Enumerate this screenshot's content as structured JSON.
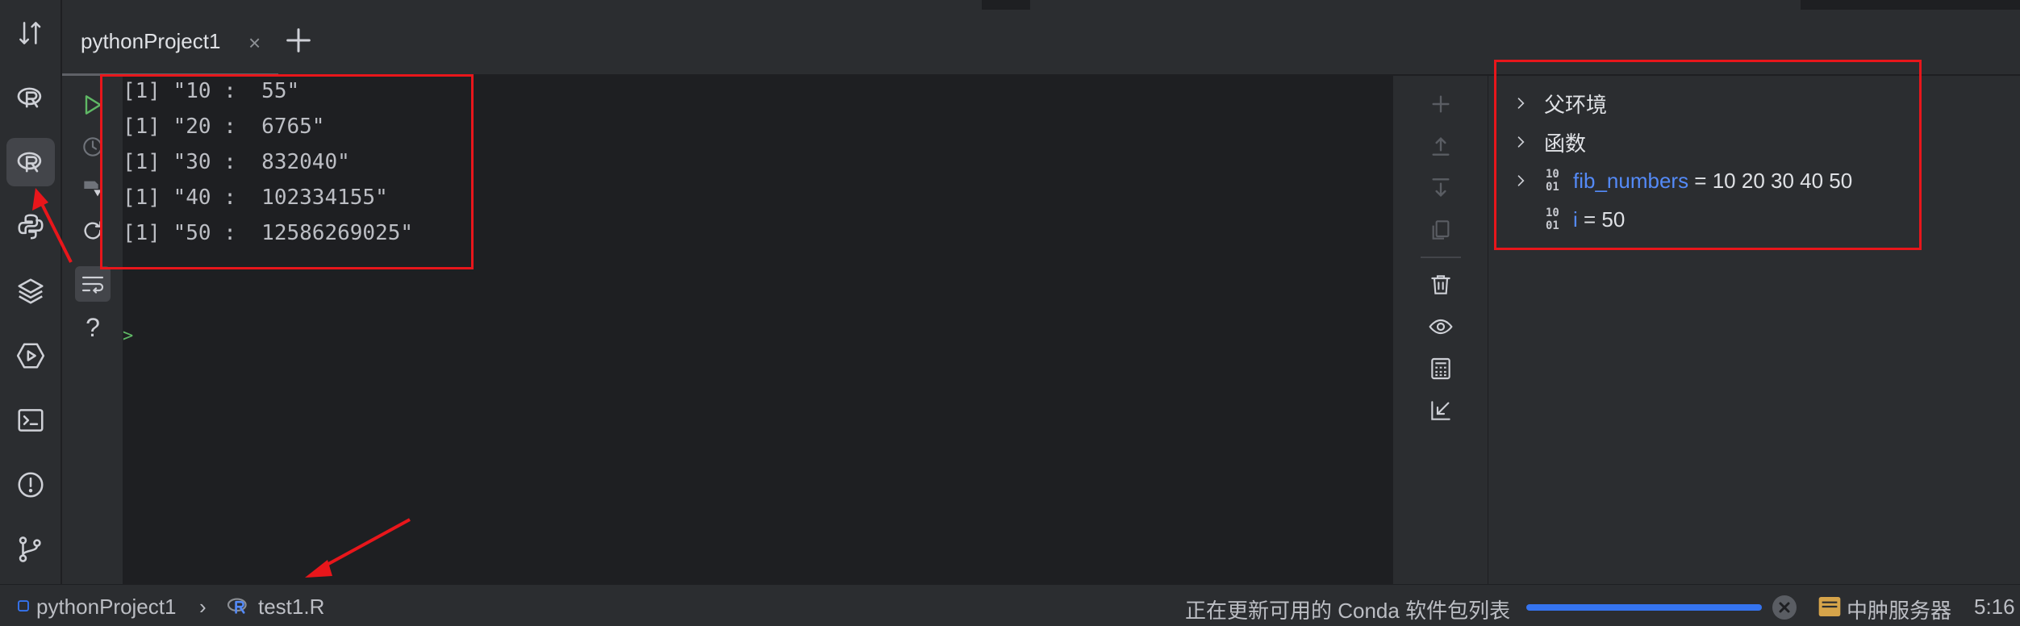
{
  "left_toolbar": {
    "icons": [
      "sort-arrows-icon",
      "r-logo-icon",
      "r-console-icon",
      "python-icon",
      "layers-icon",
      "run-services-icon",
      "terminal-icon",
      "problems-icon",
      "git-icon"
    ],
    "active": "r-console-icon"
  },
  "tabs": [
    {
      "label": "pythonProject1",
      "close": "×"
    }
  ],
  "console": {
    "lines": [
      "[1] \"10 :  55\"",
      "[1] \"20 :  6765\"",
      "[1] \"30 :  832040\"",
      "[1] \"40 :  102334155\"",
      "[1] \"50 :  12586269025\""
    ],
    "prompt": ">"
  },
  "console_gutter": {
    "icons": [
      "run-icon",
      "history-icon",
      "save-icon",
      "restart-icon",
      "soft-wrap-icon",
      "help-icon"
    ],
    "help": "?"
  },
  "variables_toolbar": {
    "icons": [
      "add-icon",
      "up-icon",
      "down-icon",
      "copy-icon",
      "delete-icon",
      "watch-icon",
      "calculator-icon",
      "collapse-icon"
    ]
  },
  "variables": {
    "parent_env": "父环境",
    "functions": "函数",
    "items": [
      {
        "name": "fib_numbers",
        "value": " = 10 20 30 40 50",
        "expandable": true
      },
      {
        "name": "i",
        "value": " = 50",
        "expandable": false
      }
    ],
    "type_icon_top": "10",
    "type_icon_bottom": "01"
  },
  "status_bar": {
    "project": "pythonProject1",
    "separator": "›",
    "file": "test1.R",
    "task": "正在更新可用的 Conda 软件包列表",
    "progress": 0.99,
    "server": "中肿服务器",
    "time": "5:16"
  },
  "colors": {
    "background": "#1e1f22",
    "panel": "#2b2d30",
    "highlight_box": "#e8161b",
    "var_name": "#548af7",
    "progress": "#3574f0"
  }
}
